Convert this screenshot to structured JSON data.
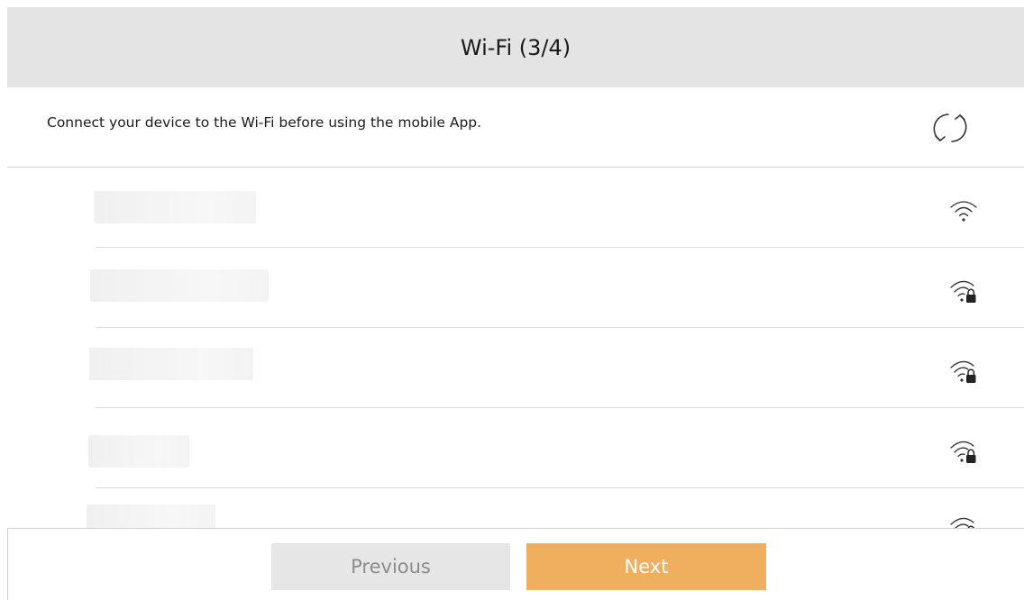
{
  "header": {
    "title": "Wi-Fi (3/4)"
  },
  "info": {
    "message": "Connect your device to the Wi-Fi before using the mobile App.",
    "refresh_icon": "refresh-icon"
  },
  "networks": [
    {
      "name": "",
      "secured": false,
      "icon": "wifi-icon"
    },
    {
      "name": "",
      "secured": true,
      "icon": "wifi-lock-icon"
    },
    {
      "name": "",
      "secured": true,
      "icon": "wifi-lock-icon"
    },
    {
      "name": "",
      "secured": true,
      "icon": "wifi-lock-icon"
    },
    {
      "name": "",
      "secured": true,
      "icon": "wifi-lock-icon"
    }
  ],
  "footer": {
    "previous_label": "Previous",
    "next_label": "Next"
  },
  "colors": {
    "header_bg": "#e4e4e4",
    "next_button": "#efaf5e",
    "previous_button": "#e6e6e6",
    "previous_text": "#8c8c8c"
  }
}
